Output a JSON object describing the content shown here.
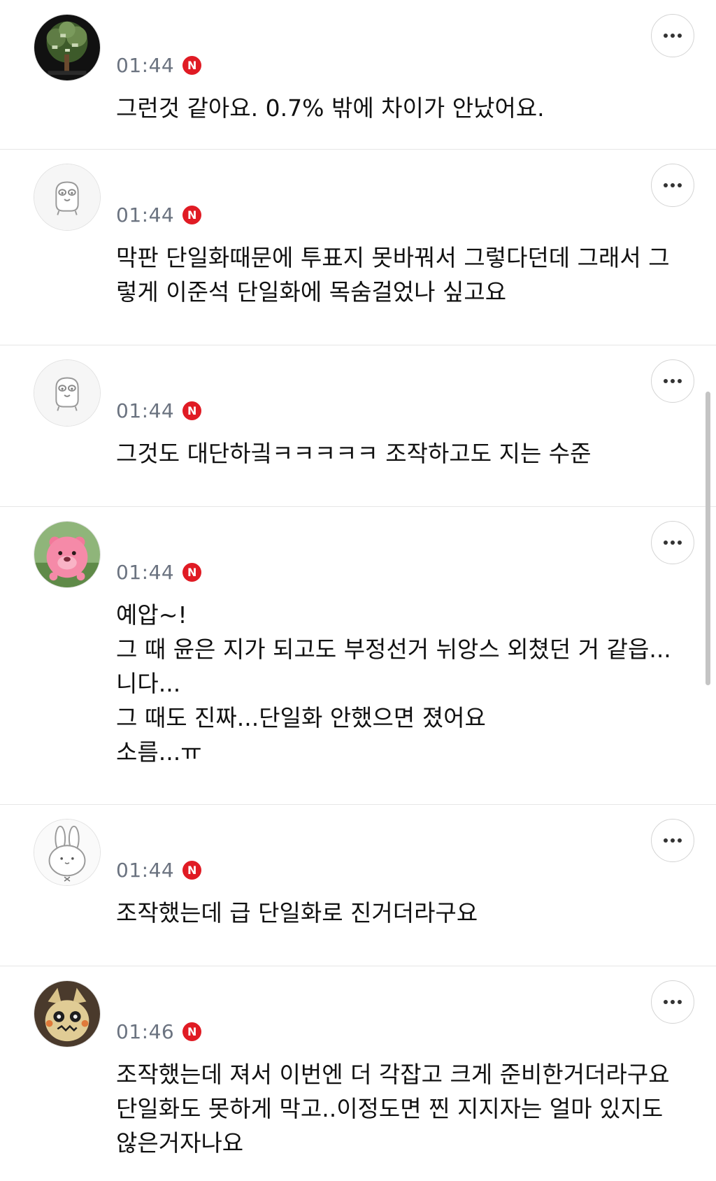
{
  "comments": [
    {
      "time": "01:44",
      "badge": "N",
      "avatar": "money-tree-avatar",
      "text": "그런것 같아요. 0.7% 밖에 차이가 안났어요."
    },
    {
      "time": "01:44",
      "badge": "N",
      "avatar": "default-character-avatar",
      "text": "막판 단일화때문에 투표지 못바꿔서 그렇다던데 그래서 그렇게 이준석 단일화에 목숨걸었나 싶고요"
    },
    {
      "time": "01:44",
      "badge": "N",
      "avatar": "default-character-avatar",
      "text": "그것도 대단하긬ㅋㅋㅋㅋㅋ 조작하고도 지는 수준"
    },
    {
      "time": "01:44",
      "badge": "N",
      "avatar": "pink-beaver-avatar",
      "text": "예압~!\n그 때 윤은 지가 되고도 부정선거 뉘앙스 외쳤던 거 같읍...니다...\n그 때도 진짜...단일화 안했으면 졌어요\n소름...ㅠ"
    },
    {
      "time": "01:44",
      "badge": "N",
      "avatar": "white-rabbit-avatar",
      "text": "조작했는데 급 단일화로 진거더라구요"
    },
    {
      "time": "01:46",
      "badge": "N",
      "avatar": "mimikyu-avatar",
      "text": "조작했는데 져서 이번엔 더 각잡고 크게 준비한거더라구요 단일화도 못하게 막고..이정도면 찐 지지자는 얼마 있지도 않은거자나요"
    }
  ],
  "icons": {
    "more": "more-options-icon"
  },
  "colors": {
    "badge": "#e01b24",
    "time": "#6b7380",
    "divider": "#e6e6e6"
  }
}
